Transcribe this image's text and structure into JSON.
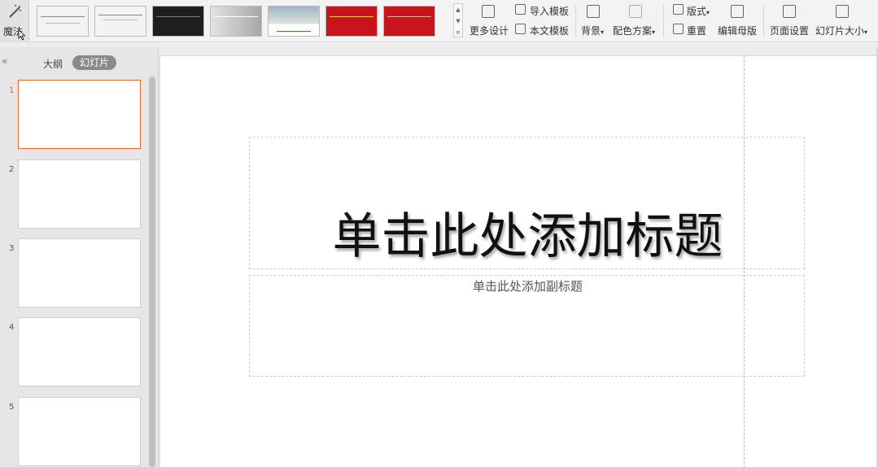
{
  "ribbon": {
    "magic_label": "魔法",
    "gallery": [
      {
        "name": "template-1",
        "bg": "#ffffff"
      },
      {
        "name": "template-2",
        "bg": "#ffffff"
      },
      {
        "name": "template-3",
        "bg": "#1e1e1e"
      },
      {
        "name": "template-4",
        "bg": "#d8d8d8"
      },
      {
        "name": "template-5",
        "bg": "#e9efe6"
      },
      {
        "name": "template-6",
        "bg": "#c8141c"
      },
      {
        "name": "template-7",
        "bg": "#c8141c"
      }
    ],
    "more_design": "更多设计",
    "import_template": "导入模板",
    "this_template": "本文模板",
    "background": "背景",
    "color_scheme": "配色方案",
    "layout": "版式",
    "reset": "重置",
    "edit_master": "编辑母版",
    "page_setup": "页面设置",
    "slide_size": "幻灯片大小"
  },
  "left_panel": {
    "collapse_icon": "«",
    "tab_outline": "大纲",
    "tab_slides": "幻灯片",
    "slides": [
      "1",
      "2",
      "3",
      "4",
      "5"
    ],
    "active_color": "#e56a2e"
  },
  "slide": {
    "title": "单击此处添加标题",
    "subtitle": "单击此处添加副标题"
  }
}
